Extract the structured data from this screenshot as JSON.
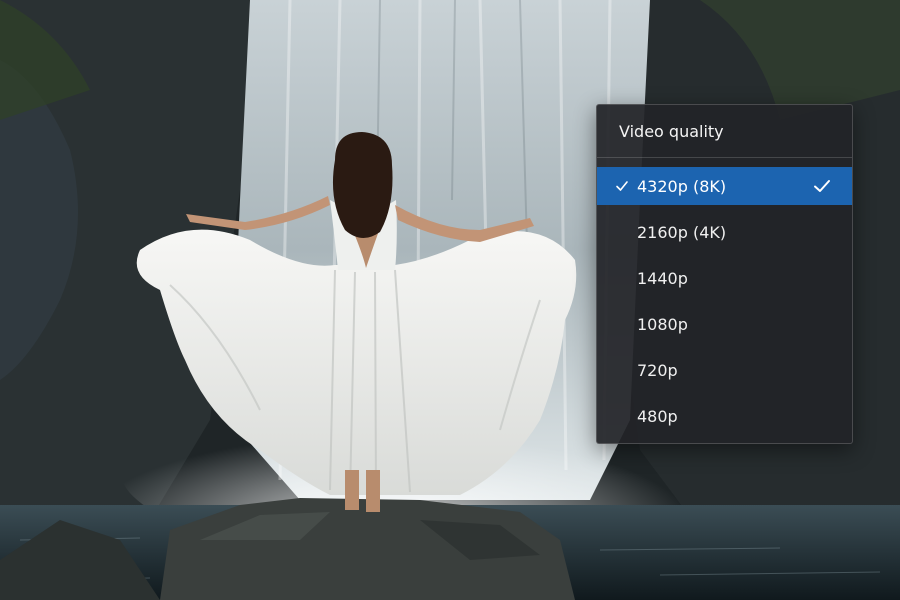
{
  "menu": {
    "title": "Video quality",
    "options": [
      {
        "label": "4320p (8K)",
        "selected": true
      },
      {
        "label": "2160p (4K)",
        "selected": false
      },
      {
        "label": "1440p",
        "selected": false
      },
      {
        "label": "1080p",
        "selected": false
      },
      {
        "label": "720p",
        "selected": false
      },
      {
        "label": "480p",
        "selected": false
      }
    ],
    "selected_index": 0,
    "accent_color": "#1c64b0",
    "background_color": "#222428"
  },
  "icons": {
    "selected_marker": "checkmark-icon"
  }
}
